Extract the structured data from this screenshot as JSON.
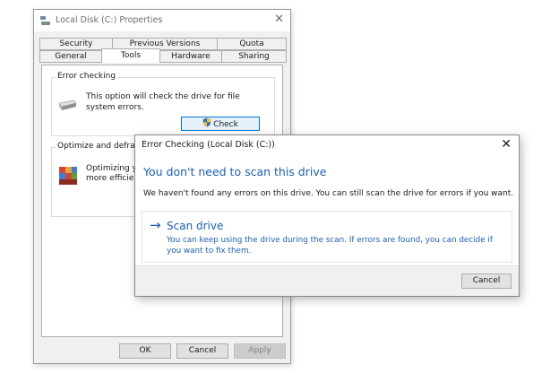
{
  "properties": {
    "title": "Local Disk (C:) Properties",
    "tabs_top": [
      "Security",
      "Previous Versions",
      "Quota"
    ],
    "tabs_bottom": [
      "General",
      "Tools",
      "Hardware",
      "Sharing"
    ],
    "active_tab": "Tools",
    "error_group": {
      "label": "Error checking",
      "text_line1": "This option will check the drive for file",
      "text_line2": "system errors.",
      "check_button": "Check"
    },
    "optimize_group": {
      "label": "Optimize and defragment",
      "label_visible": "Optimize and defragm",
      "text_line1": "Optimizing your",
      "text_line2": "more efficiently"
    },
    "buttons": {
      "ok": "OK",
      "cancel": "Cancel",
      "apply": "Apply"
    }
  },
  "dialog": {
    "title": "Error Checking (Local Disk (C:))",
    "heading": "You don't need to scan this drive",
    "info": "We haven't found any errors on this drive. You can still scan the drive for errors if you want.",
    "option": {
      "title": "Scan drive",
      "description": "You can keep using the drive during the scan. If errors are found, you can decide if you want to fix them."
    },
    "cancel_label": "Cancel"
  },
  "colors": {
    "accent_blue": "#1a5fb4",
    "window_bg": "#f0f0f0",
    "focus_border": "#0078d7"
  }
}
